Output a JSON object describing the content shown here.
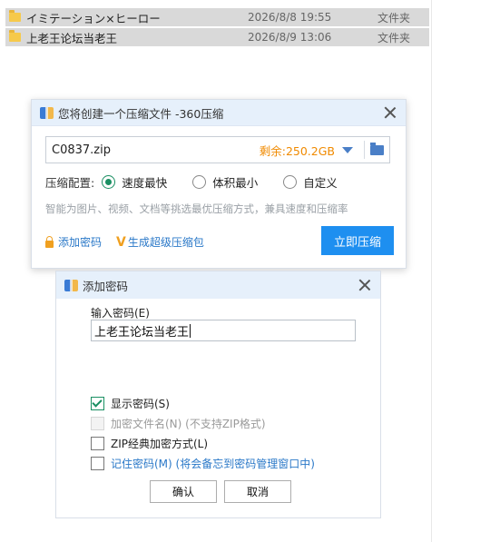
{
  "explorer": {
    "rows": [
      {
        "name": "イミテーション×ヒーロー",
        "date": "2026/8/8 19:55",
        "type": "文件夹"
      },
      {
        "name": "上老王论坛当老王",
        "date": "2026/8/9 13:06",
        "type": "文件夹"
      }
    ]
  },
  "compress_dialog": {
    "title": "您将创建一个压缩文件 -360压缩",
    "filename": "C0837.zip",
    "free_space": "剩余:250.2GB",
    "config_label": "压缩配置:",
    "options": [
      {
        "label": "速度最快",
        "checked": true
      },
      {
        "label": "体积最小",
        "checked": false
      },
      {
        "label": "自定义",
        "checked": false
      }
    ],
    "hint": "智能为图片、视频、文档等挑选最优压缩方式，兼具速度和压缩率",
    "add_password_link": "添加密码",
    "super_package_link": "生成超级压缩包",
    "compress_button": "立即压缩"
  },
  "password_dialog": {
    "title": "添加密码",
    "input_label": "输入密码(E)",
    "input_value": "上老王论坛当老王",
    "checkboxes": [
      {
        "label": "显示密码(S)",
        "checked": true,
        "disabled": false
      },
      {
        "label": "加密文件名(N) (不支持ZIP格式)",
        "checked": false,
        "disabled": true
      },
      {
        "label": "ZIP经典加密方式(L)",
        "checked": false,
        "disabled": false
      },
      {
        "label": "记住密码(M) (将会备忘到密码管理窗口中)",
        "checked": false,
        "disabled": false
      }
    ],
    "ok_button": "确认",
    "cancel_button": "取消"
  },
  "colors": {
    "accent": "#1e8ff0",
    "free_space": "#f08a00",
    "link": "#2a78c8",
    "check_green": "#1a8f62",
    "titlebar": "#e6f0fb"
  }
}
